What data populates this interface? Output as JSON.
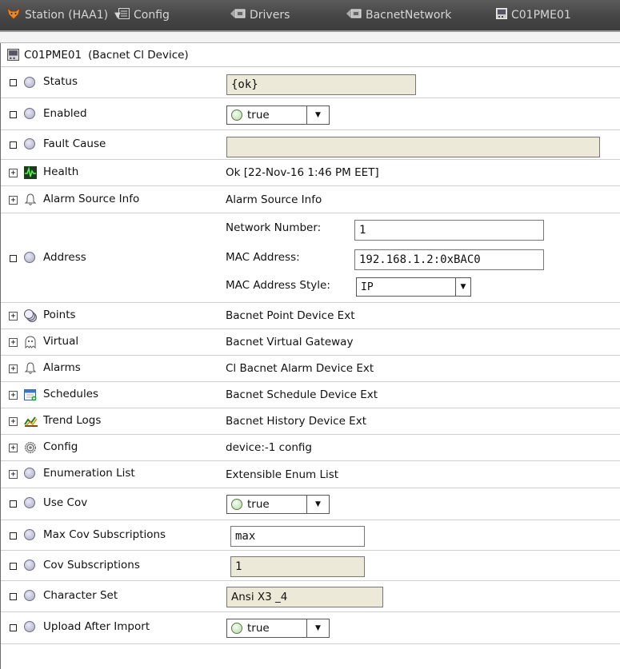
{
  "nav": {
    "station": "Station (HAA1)",
    "config": "Config",
    "drivers": "Drivers",
    "network": "BacnetNetwork",
    "device": "C01PME01"
  },
  "title": {
    "name": "C01PME01",
    "type": "(Bacnet Cl Device)"
  },
  "rows": {
    "status": {
      "label": "Status",
      "value": "{ok}"
    },
    "enabled": {
      "label": "Enabled",
      "value": "true"
    },
    "fault_cause": {
      "label": "Fault Cause",
      "value": ""
    },
    "health": {
      "label": "Health",
      "value": "Ok [22-Nov-16 1:46 PM EET]"
    },
    "alarm_source_info": {
      "label": "Alarm Source Info",
      "value": "Alarm Source Info"
    },
    "address": {
      "label": "Address",
      "network_number_label": "Network Number:",
      "network_number": "1",
      "mac_address_label": "MAC Address:",
      "mac_address": "192.168.1.2:0xBAC0",
      "mac_style_label": "MAC Address Style:",
      "mac_style": "IP"
    },
    "points": {
      "label": "Points",
      "value": "Bacnet Point Device Ext"
    },
    "virtual": {
      "label": "Virtual",
      "value": "Bacnet Virtual Gateway"
    },
    "alarms": {
      "label": "Alarms",
      "value": "Cl Bacnet Alarm Device Ext"
    },
    "schedules": {
      "label": "Schedules",
      "value": "Bacnet Schedule Device Ext"
    },
    "trend_logs": {
      "label": "Trend Logs",
      "value": "Bacnet History Device Ext"
    },
    "config": {
      "label": "Config",
      "value": "device:-1 config"
    },
    "enumeration_list": {
      "label": "Enumeration List",
      "value": "Extensible Enum List"
    },
    "use_cov": {
      "label": "Use Cov",
      "value": "true"
    },
    "max_cov_subscriptions": {
      "label": "Max Cov Subscriptions",
      "value": "max"
    },
    "cov_subscriptions": {
      "label": "Cov Subscriptions",
      "value": "1"
    },
    "character_set": {
      "label": "Character Set",
      "value": "Ansi X3 _4"
    },
    "upload_after_import": {
      "label": "Upload After Import",
      "value": "true"
    }
  },
  "colors": {
    "navbar": "#444444",
    "nav_text": "#d6d6d6",
    "readonly_field": "#ece9d8"
  }
}
